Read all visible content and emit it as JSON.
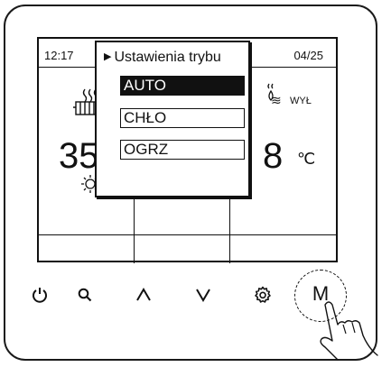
{
  "screen": {
    "time": "12:17",
    "date": "04/25",
    "temp_left": "35",
    "temp_right": "8",
    "unit": "℃",
    "off_label": "WYŁ"
  },
  "popup": {
    "title": "Ustawienia trybu",
    "options": [
      {
        "label": "AUTO",
        "selected": true
      },
      {
        "label": "CHŁO",
        "selected": false
      },
      {
        "label": "OGRZ",
        "selected": false
      }
    ]
  },
  "buttons": {
    "mode_label": "M",
    "icons": [
      "power-icon",
      "search-icon",
      "up-arrow-icon",
      "down-arrow-icon",
      "settings-icon"
    ]
  }
}
